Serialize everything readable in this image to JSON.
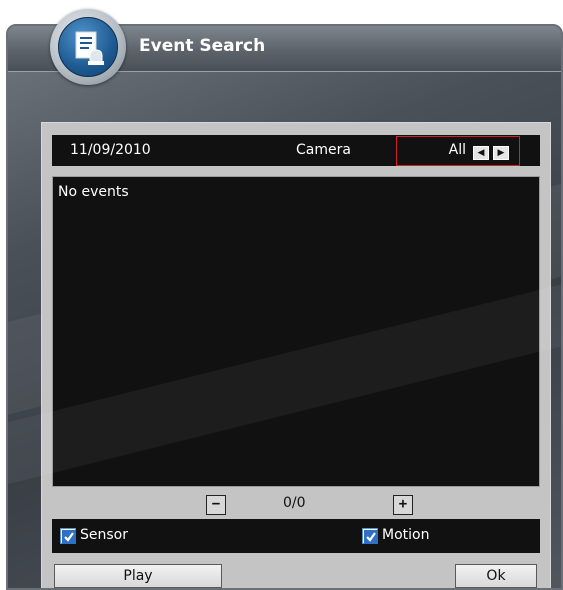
{
  "window": {
    "title": "Event Search"
  },
  "header": {
    "date": "11/09/2010",
    "camera_label": "Camera",
    "camera_value": "All",
    "prev_symbol": "◀",
    "next_symbol": "▶"
  },
  "events": {
    "empty_text": "No events",
    "items": []
  },
  "pager": {
    "minus_label": "−",
    "count": "0/0",
    "plus_label": "+"
  },
  "filters": {
    "sensor": {
      "label": "Sensor",
      "checked": true
    },
    "motion": {
      "label": "Motion",
      "checked": true
    }
  },
  "buttons": {
    "play_label": "Play",
    "ok_label": "Ok"
  },
  "colors": {
    "selection_border": "#d4202a",
    "panel_bg": "#c4c4c4",
    "dark_bg": "#111111",
    "title_text": "#ffffff"
  },
  "icons": {
    "app": "event-search-document-icon",
    "prev": "arrow-left-icon",
    "next": "arrow-right-icon",
    "check": "checkmark-icon"
  }
}
